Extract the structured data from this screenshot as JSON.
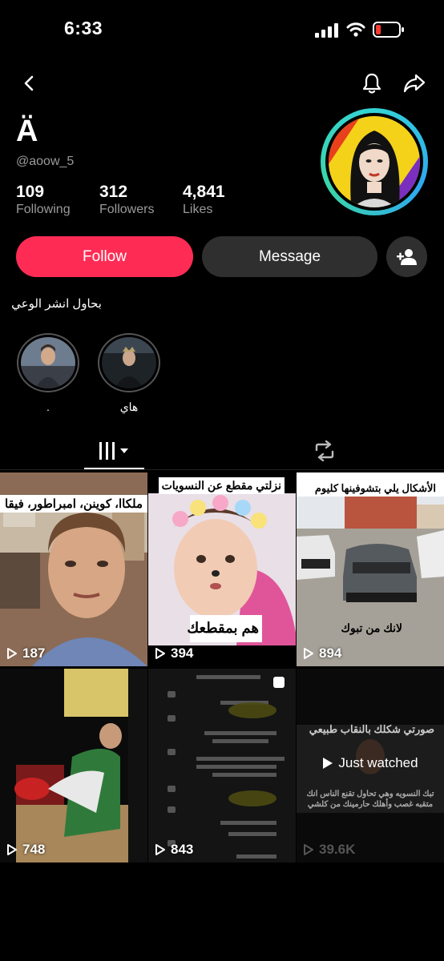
{
  "status_bar": {
    "time": "6:33"
  },
  "profile": {
    "name": "Ä",
    "handle": "@aoow_5",
    "stats": [
      {
        "value": "109",
        "label": "Following"
      },
      {
        "value": "312",
        "label": "Followers"
      },
      {
        "value": "4,841",
        "label": "Likes"
      }
    ],
    "bio": "بحاول انشر الوعي"
  },
  "actions": {
    "follow": "Follow",
    "message": "Message"
  },
  "highlights": [
    {
      "label": "."
    },
    {
      "label": "هاي"
    }
  ],
  "videos": [
    {
      "views": "187",
      "caption": "ملكاا، كوينن، امبراطور، فيقا"
    },
    {
      "views": "394",
      "caption": "نزلتي مقطع عن النسويات",
      "caption2": "هم بمقطعك"
    },
    {
      "views": "894",
      "caption": "الأشكال يلي بتشوفينها كليوم",
      "caption2": "لانك من تبوك"
    },
    {
      "views": "748"
    },
    {
      "views": "843"
    },
    {
      "views": "39.6K",
      "caption": "صورتي شكلك بالنقاب طبيعي",
      "overlay": "Just watched",
      "caption2": "تبك النسويه وهي تحاول تقنع الناس انك متقبه غصب وأهلك حارمينك من كلشي"
    }
  ]
}
